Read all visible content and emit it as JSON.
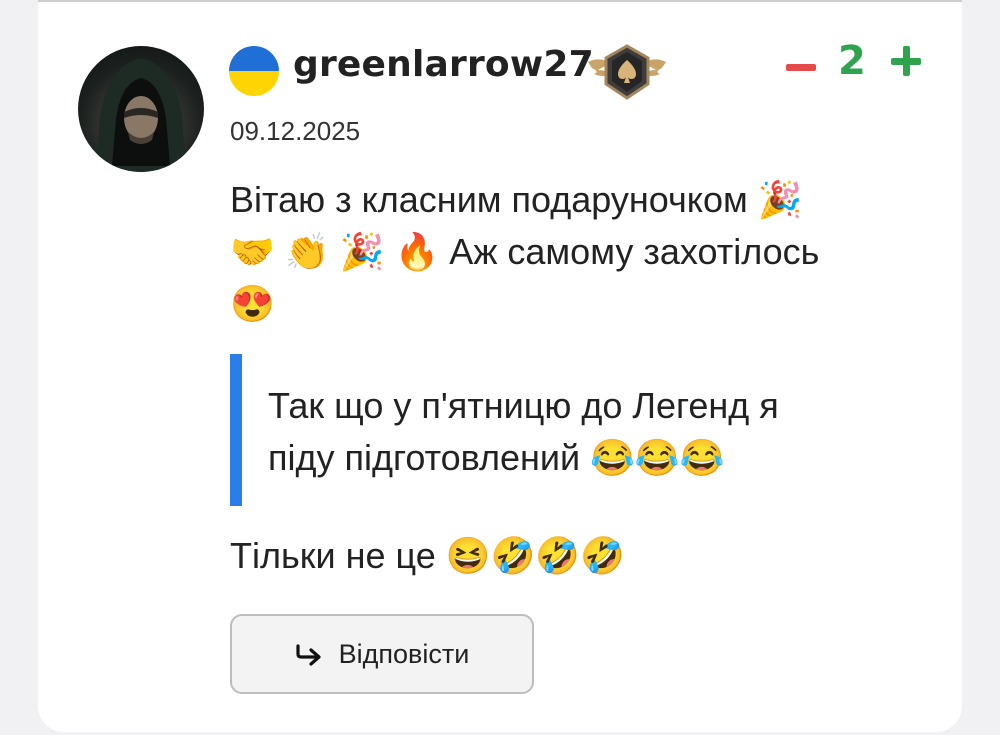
{
  "comment": {
    "username": "greenlarrow27",
    "country_flag_icon": "ukraine-flag-icon",
    "rank_icon": "spade-winged-badge-icon",
    "date": "09.12.2025",
    "score": "2",
    "message_lines": [
      "Вітаю з класним подаруночком 🎉",
      "🤝 👏 🎉 🔥 Аж самому захотілось",
      "😍"
    ],
    "quote_lines": [
      "Так що у п'ятницю до Легенд я",
      "піду підготовлений 😂😂😂"
    ],
    "footer_text": "Тільки не це 😆🤣🤣🤣",
    "reply_label": "Відповісти"
  },
  "colors": {
    "minus": "#e44a4a",
    "plus": "#2ea44f",
    "quote_bar": "#2b7de9"
  }
}
